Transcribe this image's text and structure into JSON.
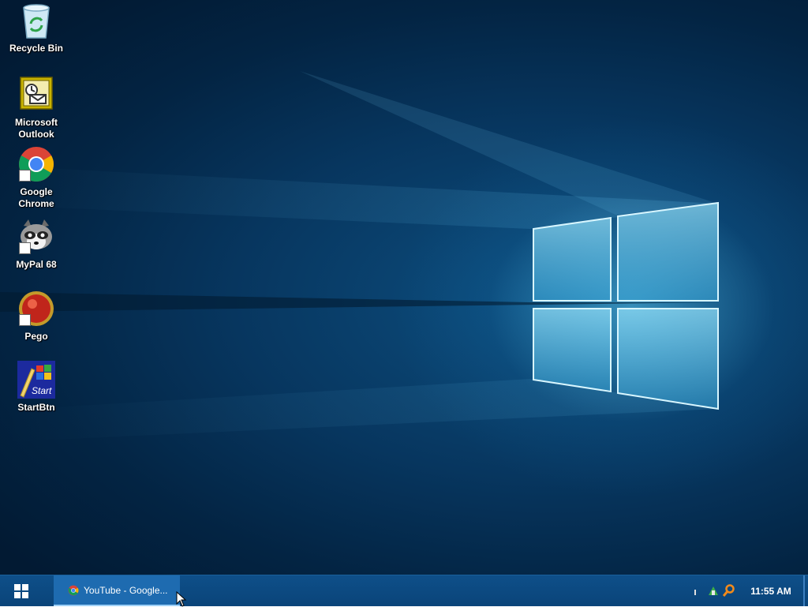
{
  "desktop": {
    "icons": [
      {
        "label": "Recycle Bin",
        "icon": "recycle-bin-icon"
      },
      {
        "label": "Microsoft Outlook",
        "icon": "outlook-icon"
      },
      {
        "label": "Google Chrome",
        "icon": "chrome-icon"
      },
      {
        "label": "MyPal 68",
        "icon": "mypal-raccoon-icon"
      },
      {
        "label": "Pego",
        "icon": "pego-icon"
      },
      {
        "label": "StartBtn",
        "icon": "startbtn-icon"
      }
    ]
  },
  "taskbar": {
    "start_icon": "windows-logo-icon",
    "tasks": [
      {
        "label": "YouTube - Google...",
        "icon": "chrome-icon",
        "active": true
      }
    ],
    "tray": {
      "icons": [
        "network-icon",
        "search-tray-icon"
      ],
      "clock": "11:55 AM"
    }
  },
  "colors": {
    "taskbar": "#0a4479",
    "active_task": "#1e6bb0",
    "wallpaper_glow": "#5ac8f0"
  }
}
